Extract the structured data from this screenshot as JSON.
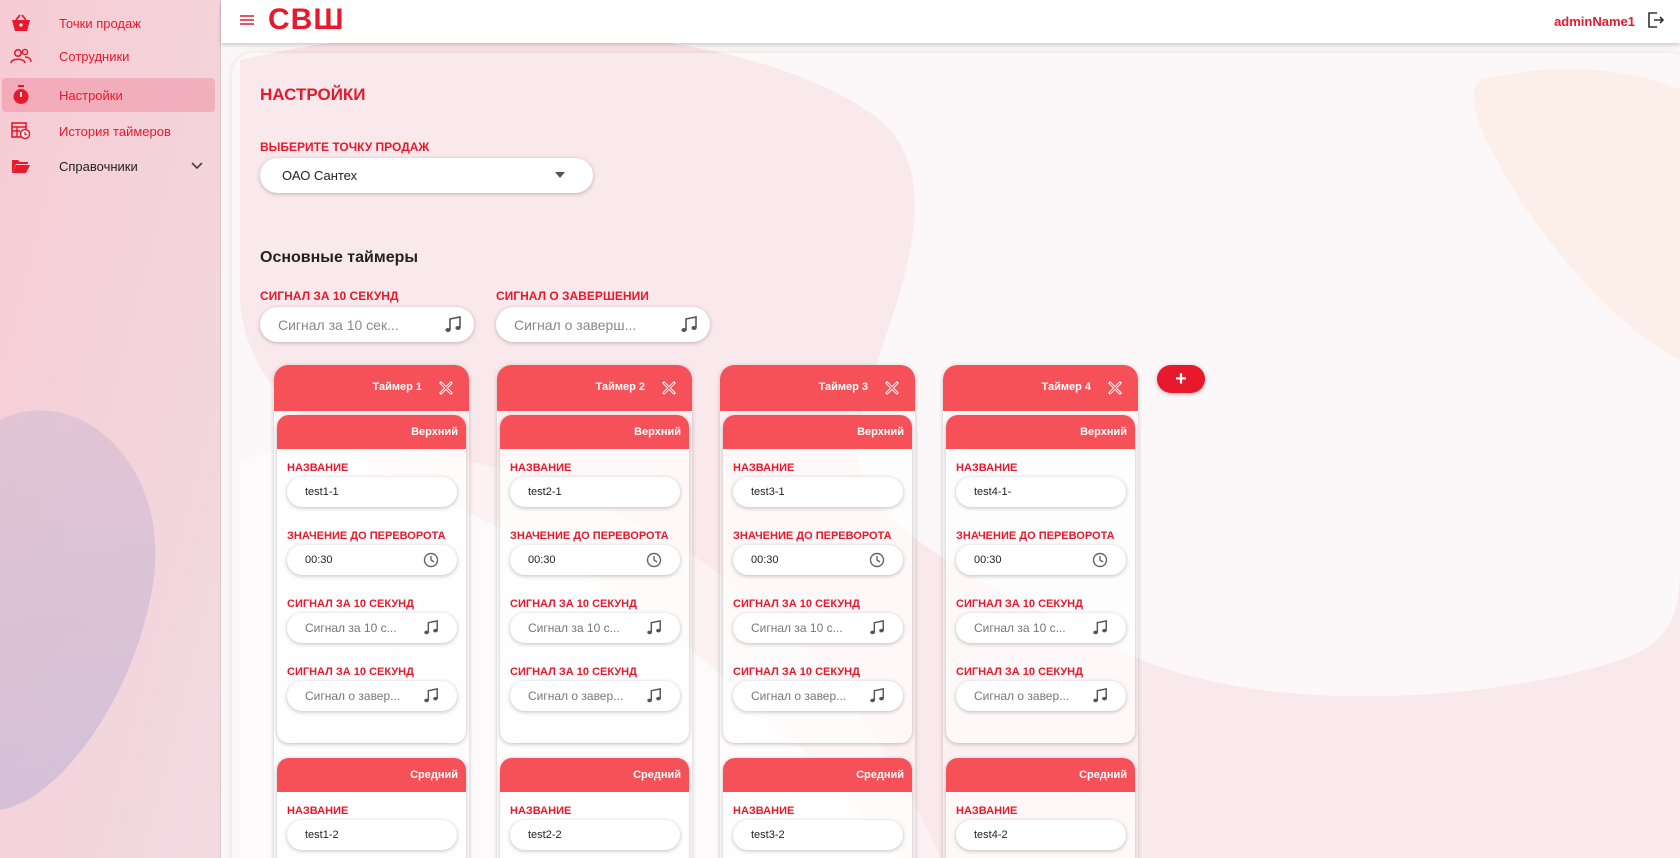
{
  "colors": {
    "accent": "#e8192c",
    "header_red": "#f65159"
  },
  "sidebar": {
    "items": [
      {
        "label": "Точки продаж",
        "icon": "basket-icon"
      },
      {
        "label": "Сотрудники",
        "icon": "people-icon"
      },
      {
        "label": "Настройки",
        "icon": "stopwatch-icon",
        "active": true
      },
      {
        "label": "История таймеров",
        "icon": "history-table-icon"
      },
      {
        "label": "Справочники",
        "icon": "folder-icon",
        "expandable": true
      }
    ]
  },
  "header": {
    "logo": "СВШ",
    "username": "adminName1"
  },
  "page": {
    "title": "НАСТРОЙКИ",
    "select_label": "ВЫБЕРИТЕ ТОЧКУ ПРОДАЖ",
    "select_value": "ОАО Сантех",
    "section_title": "Основные таймеры",
    "signal10_label": "СИГНАЛ ЗА 10 СЕКУНД",
    "signal10_placeholder": "Сигнал за 10 сек...",
    "signal_end_label": "СИГНАЛ О ЗАВЕРШЕНИИ",
    "signal_end_placeholder": "Сигнал о заверш...",
    "add_button": "+"
  },
  "timers": [
    {
      "name": "Таймер 1",
      "sections": [
        {
          "title": "Верхний",
          "name_label": "НАЗВАНИЕ",
          "name_value": "test1-1",
          "flip_label": "ЗНАЧЕНИЕ ДО ПЕРЕВОРОТА",
          "flip_value": "00:30",
          "sig1_label": "СИГНАЛ ЗА 10 СЕКУНД",
          "sig1_placeholder": "Сигнал за 10 с...",
          "sig2_label": "СИГНАЛ ЗА 10 СЕКУНД",
          "sig2_placeholder": "Сигнал о завер..."
        },
        {
          "title": "Средний",
          "name_label": "НАЗВАНИЕ",
          "name_value": "test1-2"
        }
      ]
    },
    {
      "name": "Таймер 2",
      "sections": [
        {
          "title": "Верхний",
          "name_label": "НАЗВАНИЕ",
          "name_value": "test2-1",
          "flip_label": "ЗНАЧЕНИЕ ДО ПЕРЕВОРОТА",
          "flip_value": "00:30",
          "sig1_label": "СИГНАЛ ЗА 10 СЕКУНД",
          "sig1_placeholder": "Сигнал за 10 с...",
          "sig2_label": "СИГНАЛ ЗА 10 СЕКУНД",
          "sig2_placeholder": "Сигнал о завер..."
        },
        {
          "title": "Средний",
          "name_label": "НАЗВАНИЕ",
          "name_value": "test2-2"
        }
      ]
    },
    {
      "name": "Таймер 3",
      "sections": [
        {
          "title": "Верхний",
          "name_label": "НАЗВАНИЕ",
          "name_value": "test3-1",
          "flip_label": "ЗНАЧЕНИЕ ДО ПЕРЕВОРОТА",
          "flip_value": "00:30",
          "sig1_label": "СИГНАЛ ЗА 10 СЕКУНД",
          "sig1_placeholder": "Сигнал за 10 с...",
          "sig2_label": "СИГНАЛ ЗА 10 СЕКУНД",
          "sig2_placeholder": "Сигнал о завер..."
        },
        {
          "title": "Средний",
          "name_label": "НАЗВАНИЕ",
          "name_value": "test3-2"
        }
      ]
    },
    {
      "name": "Таймер 4",
      "sections": [
        {
          "title": "Верхний",
          "name_label": "НАЗВАНИЕ",
          "name_value": "test4-1-",
          "flip_label": "ЗНАЧЕНИЕ ДО ПЕРЕВОРОТА",
          "flip_value": "00:30",
          "sig1_label": "СИГНАЛ ЗА 10 СЕКУНД",
          "sig1_placeholder": "Сигнал за 10 с...",
          "sig2_label": "СИГНАЛ ЗА 10 СЕКУНД",
          "sig2_placeholder": "Сигнал о завер..."
        },
        {
          "title": "Средний",
          "name_label": "НАЗВАНИЕ",
          "name_value": "test4-2"
        }
      ]
    }
  ]
}
